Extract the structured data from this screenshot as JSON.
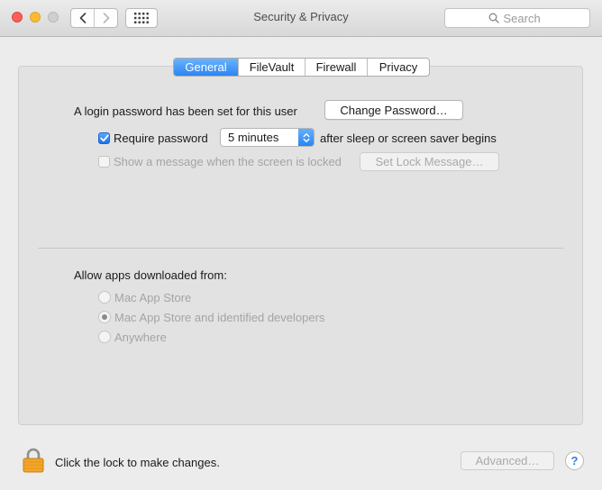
{
  "window": {
    "title": "Security & Privacy"
  },
  "toolbar": {
    "search_placeholder": "Search",
    "back_icon": "chevron-left-icon",
    "forward_icon": "chevron-right-icon",
    "show_all_icon": "grid-icon"
  },
  "tabs": [
    {
      "label": "General",
      "active": true
    },
    {
      "label": "FileVault",
      "active": false
    },
    {
      "label": "Firewall",
      "active": false
    },
    {
      "label": "Privacy",
      "active": false
    }
  ],
  "general": {
    "login_password_text": "A login password has been set for this user",
    "change_password_label": "Change Password…",
    "require_password": {
      "label": "Require password",
      "checked": true,
      "delay_value": "5 minutes",
      "suffix": "after sleep or screen saver begins"
    },
    "show_message": {
      "label": "Show a message when the screen is locked",
      "checked": false,
      "enabled": false
    },
    "set_lock_message_label": "Set Lock Message…"
  },
  "allow_apps": {
    "heading": "Allow apps downloaded from:",
    "options": [
      {
        "label": "Mac App Store",
        "selected": false
      },
      {
        "label": "Mac App Store and identified developers",
        "selected": true
      },
      {
        "label": "Anywhere",
        "selected": false
      }
    ]
  },
  "footer": {
    "lock_text": "Click the lock to make changes.",
    "advanced_label": "Advanced…",
    "help_label": "?"
  },
  "colors": {
    "accent": "#2a85f4",
    "close": "#fc5f57",
    "minimize": "#fdbc2e",
    "lock": "#f3a52b"
  }
}
